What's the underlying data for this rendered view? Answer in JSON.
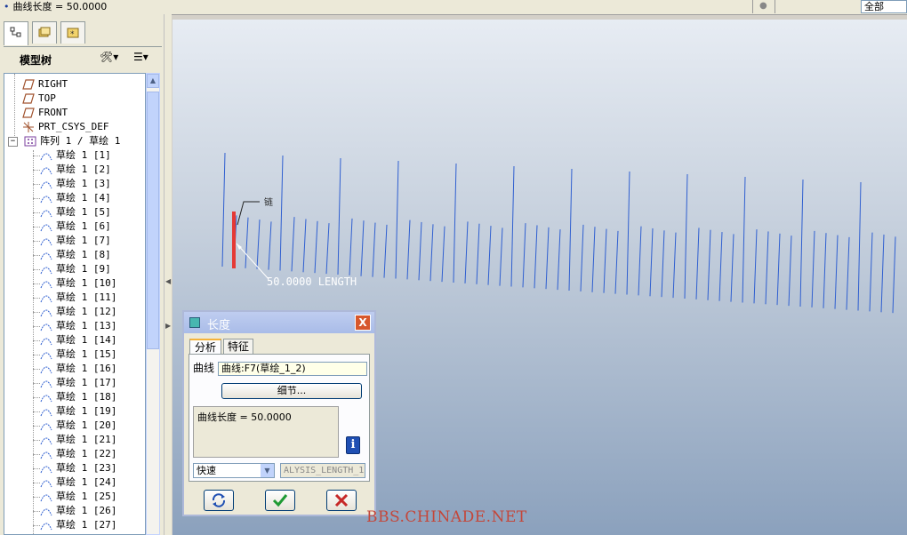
{
  "status_bar": {
    "message": "曲线长度 = 50.0000",
    "filter_value": "全部"
  },
  "model_tree": {
    "header_title": "模型树",
    "top_items": [
      {
        "label": "RIGHT",
        "icon": "datum-plane-icon"
      },
      {
        "label": "TOP",
        "icon": "datum-plane-icon"
      },
      {
        "label": "FRONT",
        "icon": "datum-plane-icon"
      },
      {
        "label": "PRT_CSYS_DEF",
        "icon": "csys-icon"
      }
    ],
    "pattern": {
      "label": "阵列 1 / 草绘 1",
      "toggle": "−"
    },
    "sketches": [
      "草绘 1 [1]",
      "草绘 1 [2]",
      "草绘 1 [3]",
      "草绘 1 [4]",
      "草绘 1 [5]",
      "草绘 1 [6]",
      "草绘 1 [7]",
      "草绘 1 [8]",
      "草绘 1 [9]",
      "草绘 1 [10]",
      "草绘 1 [11]",
      "草绘 1 [12]",
      "草绘 1 [13]",
      "草绘 1 [14]",
      "草绘 1 [15]",
      "草绘 1 [16]",
      "草绘 1 [17]",
      "草绘 1 [18]",
      "草绘 1 [19]",
      "草绘 1 [20]",
      "草绘 1 [21]",
      "草绘 1 [22]",
      "草绘 1 [23]",
      "草绘 1 [24]",
      "草绘 1 [25]",
      "草绘 1 [26]",
      "草绘 1 [27]"
    ]
  },
  "graphics": {
    "annotation": "50.0000 LENGTH",
    "tag": "链"
  },
  "dialog": {
    "title": "长度",
    "close_glyph": "X",
    "tabs": [
      "分析",
      "特征"
    ],
    "curve_label": "曲线",
    "curve_value": "曲线:F7(草绘_1_2)",
    "details_button": "细节...",
    "result": "曲线长度 = 50.0000",
    "info_glyph": "i",
    "mode_value": "快速",
    "feature_name": "ALYSIS_LENGTH_1"
  },
  "watermark": "BBS.CHINADE.NET",
  "colors": {
    "highlight": "#e53935",
    "curve": "#2f5fd0",
    "ok": "#1f9a34",
    "cancel": "#c62828"
  }
}
